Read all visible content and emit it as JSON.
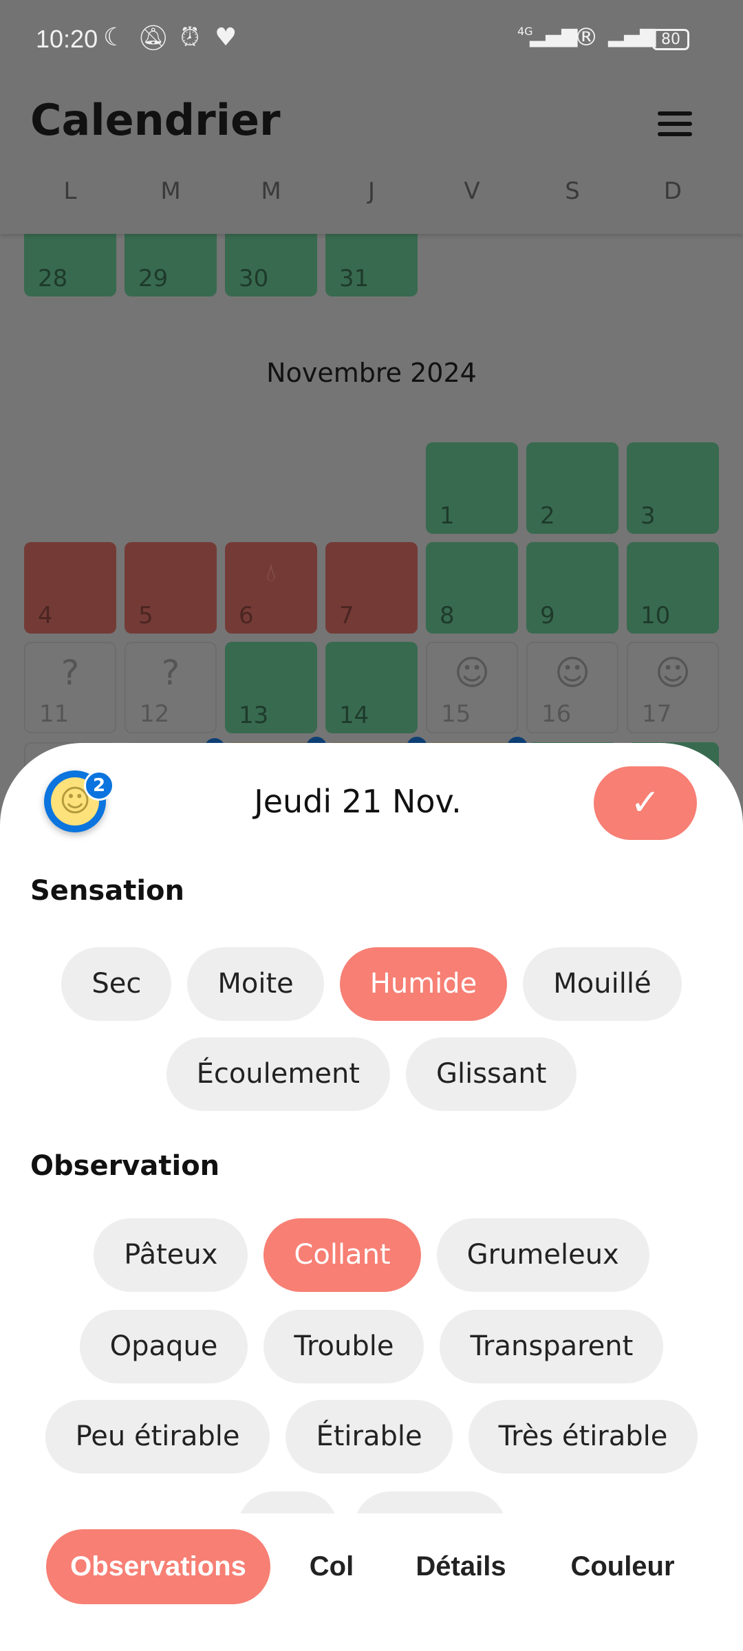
{
  "status_bar": {
    "time": "10:20",
    "icons": [
      "moon-icon",
      "bell-off-icon",
      "alarm-icon",
      "heart-icon"
    ],
    "network": "4G",
    "battery": "80"
  },
  "header": {
    "title": "Calendrier",
    "weekdays": [
      "L",
      "M",
      "M",
      "J",
      "V",
      "S",
      "D"
    ]
  },
  "calendar": {
    "october_tail": [
      {
        "day": "28",
        "status": "green"
      },
      {
        "day": "29",
        "status": "green"
      },
      {
        "day": "30",
        "status": "green"
      },
      {
        "day": "31",
        "status": "green"
      }
    ],
    "month_title": "Novembre 2024",
    "november": [
      {
        "day": "1",
        "status": "green"
      },
      {
        "day": "2",
        "status": "green"
      },
      {
        "day": "3",
        "status": "green"
      },
      {
        "day": "4",
        "status": "red"
      },
      {
        "day": "5",
        "status": "red"
      },
      {
        "day": "6",
        "status": "red",
        "icon": "drop-icon"
      },
      {
        "day": "7",
        "status": "red"
      },
      {
        "day": "8",
        "status": "green"
      },
      {
        "day": "9",
        "status": "green"
      },
      {
        "day": "10",
        "status": "green"
      },
      {
        "day": "11",
        "status": "gray",
        "icon": "question-icon"
      },
      {
        "day": "12",
        "status": "gray",
        "icon": "question-icon"
      },
      {
        "day": "13",
        "status": "green"
      },
      {
        "day": "14",
        "status": "green"
      },
      {
        "day": "15",
        "status": "gray",
        "icon": "baby-icon"
      },
      {
        "day": "16",
        "status": "gray",
        "icon": "baby-icon"
      },
      {
        "day": "17",
        "status": "gray",
        "icon": "baby-icon"
      },
      {
        "day": "",
        "status": "gray"
      },
      {
        "day": "",
        "status": "gray",
        "dot": true
      },
      {
        "day": "",
        "status": "yellow",
        "dot": true
      },
      {
        "day": "",
        "status": "yellow",
        "dot": true
      },
      {
        "day": "",
        "status": "yellow",
        "dot": true
      },
      {
        "day": "",
        "status": "green"
      },
      {
        "day": "",
        "status": "green"
      }
    ]
  },
  "sheet": {
    "title": "Jeudi 21 Nov.",
    "badge_count": "2",
    "confirm_icon": "check-icon",
    "sensation": {
      "label": "Sensation",
      "options": [
        "Sec",
        "Moite",
        "Humide",
        "Mouillé",
        "Écoulement",
        "Glissant"
      ],
      "selected": "Humide"
    },
    "observation": {
      "label": "Observation",
      "options": [
        "Pâteux",
        "Collant",
        "Grumeleux",
        "Opaque",
        "Trouble",
        "Transparent",
        "Peu étirable",
        "Étirable",
        "Très étirable"
      ],
      "selected": "Collant"
    }
  },
  "tabs": [
    {
      "label": "Observations",
      "active": true
    },
    {
      "label": "Col"
    },
    {
      "label": "Détails"
    },
    {
      "label": "Couleur"
    }
  ],
  "colors": {
    "accent": "#f77f74",
    "green": "#386a4f",
    "red": "#743b36",
    "blue": "#0b74de"
  }
}
